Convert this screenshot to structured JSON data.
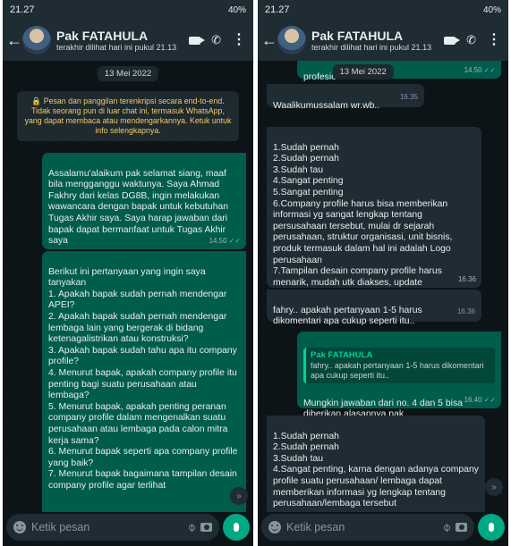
{
  "status_bar": {
    "time": "21.27",
    "right": "40%"
  },
  "contact": {
    "name": "Pak FATAHULA",
    "last_seen": "terakhir dilihat hari ini pukul 21.13"
  },
  "left": {
    "date_chip": "13 Mei 2022",
    "encryption_notice": "🔒 Pesan dan panggilan terenkripsi secara end-to-end. Tidak seorang pun di luar chat ini, termasuk WhatsApp, yang dapat membaca atau mendengarkannya. Ketuk untuk info selengkapnya.",
    "messages": [
      {
        "text": "Assalamu'alaikum pak selamat siang, maaf bila mengganggu waktunya. Saya Ahmad Fakhry dari kelas DG8B, ingin melakukan wawancara dengan bapak untuk kebutuhan Tugas Akhir saya. Saya harap jawaban dari bapak dapat bermanfaat untuk Tugas Akhir saya",
        "time": "14.50",
        "tick": "✓✓"
      },
      {
        "text": "Berikut ini pertanyaan yang ingin saya tanyakan\n1. Apakah bapak sudah pernah mendengar APEI?\n2. Apakah bapak sudah pernah mendengar lembaga lain yang bergerak di bidang ketenagalistrikan atau konstruksi?\n3. Apakah bapak sudah tahu apa itu company profile?\n4. Menurut bapak, apakah company profile itu penting bagi suatu perusahaan atau lembaga?\n5. Menurut bapak, apakah penting peranan company profile dalam mengenalkan suatu perusahaan atau lembaga pada calon mitra kerja sama?\n6. Menurut bapak seperti apa company profile yang baik?\n7. Menurut bapak bagaimana tampilan desain company profile agar terlihat"
      }
    ]
  },
  "right": {
    "partial_message": {
      "text": "profesional?",
      "time": "14.50",
      "tick": "✓✓"
    },
    "date_chip": "13 Mei 2022",
    "messages": [
      {
        "text": "Waalikumussalam wr.wb..",
        "time": "16.35"
      },
      {
        "text": "1.Sudah pernah\n2.Sudah pernah\n3.Sudah tau\n4.Sangat penting\n5.Sangat penting\n6.Company profile harus bisa memberikan informasi yg sangat lengkap tentang persusahaan tersebut, mulai dr sejarah perusahaan, struktur organisasi, unit bisnis, produk termasuk dalam hal ini adalah Logo perusahaan\n7.Tampilan desain company profile harus menarik, mudah utk diakses, update",
        "time": "16.36"
      },
      {
        "text": "fahry.. apakah pertanyaan 1-5 harus dikomentari apa cukup seperti itu..",
        "time": "16.36"
      },
      {
        "quote_name": "Pak FATAHULA",
        "quote_text": "fahry.. apakah pertanyaan 1-5 harus dikomentari apa cukup seperti itu..",
        "text": "Mungkin jawaban dari no. 4 dan 5 bisa diberikan alasannya pak",
        "time": "16.40",
        "tick": "✓✓"
      },
      {
        "text": "1.Sudah pernah\n2.Sudah pernah\n3.Sudah tau\n4.Sangat penting, karna dengan adanya company profile suatu perusahaan/ lembaga dapat memberikan informasi yg lengkap tentang perusahaan/lembaga tersebut"
      }
    ]
  },
  "input": {
    "placeholder": "Ketik pesan"
  },
  "icons": {
    "scroll_down": "»"
  }
}
